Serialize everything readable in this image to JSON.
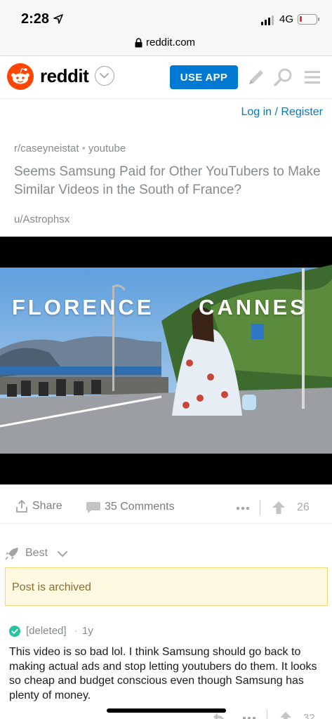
{
  "status_bar": {
    "time": "2:28",
    "network": "4G",
    "battery_color": "#e0322b",
    "battery_level": 0.12
  },
  "browser": {
    "url": "reddit.com"
  },
  "header": {
    "wordmark": "reddit",
    "use_app_label": "USE APP",
    "brand_color": "#ff4500",
    "accent_color": "#0079d3",
    "icons": [
      "reddit-logo-icon",
      "chevron-down-icon",
      "pencil-icon",
      "search-icon",
      "menu-icon"
    ]
  },
  "auth": {
    "login_label": "Log in / Register"
  },
  "post": {
    "subreddit": "r/caseyneistat",
    "domain": "youtube",
    "title": "Seems Samsung Paid for Other YouTubers to Make Similar Videos in the South of France?",
    "author": "u/Astrophsx",
    "video": {
      "overlay_left": "FLORENCE",
      "overlay_right": "CANNES"
    },
    "actions": {
      "share_label": "Share",
      "comments_label": "35 Comments",
      "score": "26"
    }
  },
  "sort": {
    "label": "Best"
  },
  "archived_notice": "Post is archived",
  "comments": [
    {
      "user": "[deleted]",
      "time": "1y",
      "body": "This video is so bad lol. I think Samsung should go back to making actual ads and stop letting youtubers do them. It looks so cheap and budget conscious even though Samsung has plenty of money.",
      "score": "32"
    }
  ]
}
